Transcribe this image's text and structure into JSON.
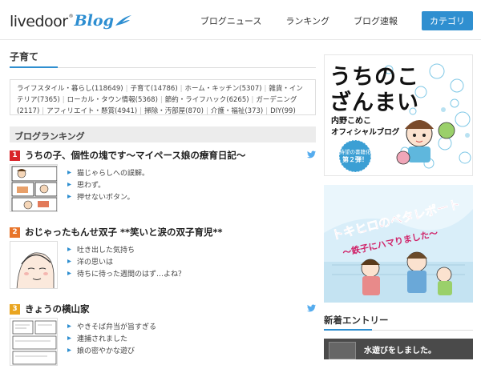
{
  "header": {
    "logo_main": "livedoor",
    "logo_reg": "®",
    "logo_blog": "Blog",
    "nav": [
      {
        "label": "ブログニュース"
      },
      {
        "label": "ランキング"
      },
      {
        "label": "ブログ速報"
      }
    ],
    "category_button": "カテゴリ"
  },
  "section": {
    "title": "子育て"
  },
  "categories": [
    "ライフスタイル・暮らし(118649)",
    "子育て(14786)",
    "ホーム・キッチン(5307)",
    "雑貨・インテリア(7365)",
    "ローカル・タウン情報(5368)",
    "節約・ライフハック(6265)",
    "ガーデニング(2117)",
    "アフィリエイト・懸賞(4941)",
    "掃除・汚部屋(870)",
    "介護・福祉(373)",
    "DIY(99)"
  ],
  "ranking": {
    "header": "ブログランキング",
    "items": [
      {
        "rank": "1",
        "rank_color": "#d9242a",
        "title": "うちの子、個性の塊です〜マイペース娘の療育日記〜",
        "entries": [
          "猫じゃらしへの誤解。",
          "思わず。",
          "押せないボタン。"
        ]
      },
      {
        "rank": "2",
        "rank_color": "#e8742a",
        "title": "おじゃったもんせ双子 **笑いと涙の双子育児**",
        "entries": [
          "吐き出した気持ち",
          "洋の思いは",
          "待ちに待った週間のはず…よね？"
        ]
      },
      {
        "rank": "3",
        "rank_color": "#e9a521",
        "title": "きょうの横山家",
        "entries": [
          "やきそば弁当が旨すぎる",
          "連捕されました",
          "娘の密やかな遊び"
        ]
      }
    ]
  },
  "sidebar": {
    "banner1": {
      "title_line1": "うちのこ",
      "title_line2": "ざんまい",
      "author": "内野こめこ",
      "subtitle": "オフィシャルブログ",
      "badge_line1": "待望の書籍化",
      "badge_line2": "第２弾！"
    },
    "banner2": {
      "title": "トキヒロのベタレポート",
      "subtitle": "〜鉄子にハマりました〜"
    },
    "new_entries_title": "新着エントリー",
    "new_entry": "水遊びをしました。"
  },
  "colors": {
    "accent": "#2f8fd0",
    "twitter": "#55acee"
  }
}
